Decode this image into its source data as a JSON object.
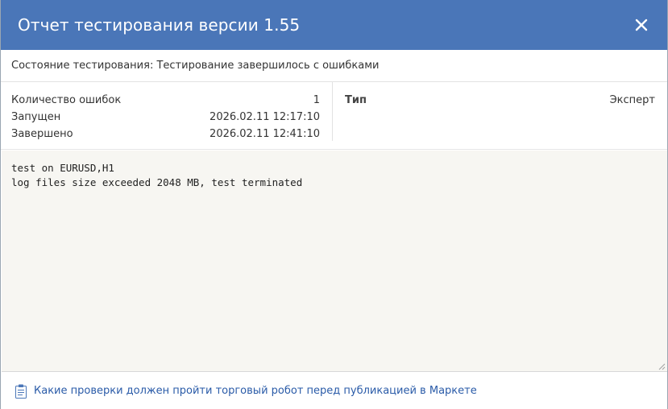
{
  "window": {
    "title": "Отчет тестирования версии 1.55"
  },
  "status": {
    "label": "Состояние тестирования:",
    "value": "Тестирование завершилось с ошибками"
  },
  "details": {
    "errors_label": "Количество ошибок",
    "errors_value": "1",
    "started_label": "Запущен",
    "started_value": "2026.02.11 12:17:10",
    "finished_label": "Завершено",
    "finished_value": "2026.02.11 12:41:10",
    "type_label": "Тип",
    "type_value": "Эксперт"
  },
  "log": {
    "text": "test on EURUSD,H1\nlog files size exceeded 2048 MB, test terminated"
  },
  "footer": {
    "link_label": "Какие проверки должен пройти торговый робот перед публикацией в Маркете"
  },
  "icons": {
    "close": "close-icon",
    "doc": "clipboard-icon"
  },
  "colors": {
    "titlebar": "#4a76b8",
    "link": "#2a5ba8",
    "log_bg": "#f7f6f2"
  }
}
